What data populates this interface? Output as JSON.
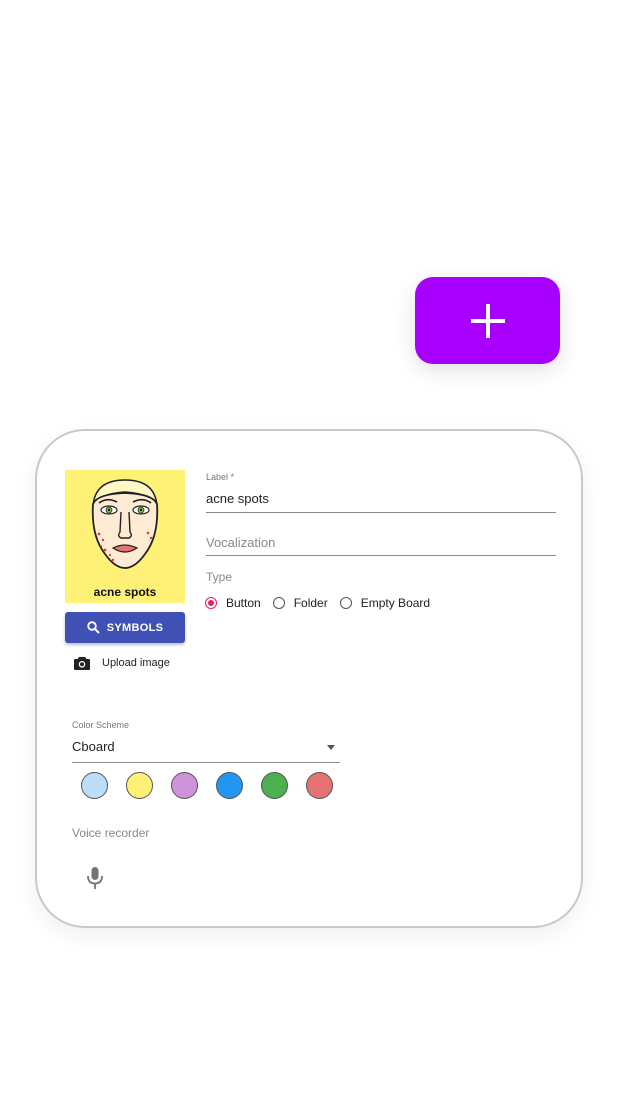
{
  "fab": {
    "icon": "plus-icon",
    "color": "#a700ff"
  },
  "tile": {
    "label": "acne spots",
    "background": "#fff176",
    "image": "face-with-acne-symbol"
  },
  "symbols_button": {
    "label": "SYMBOLS",
    "icon": "search-icon",
    "color": "#3f51b5"
  },
  "upload": {
    "label": "Upload image",
    "icon": "camera-icon"
  },
  "label_field": {
    "label": "Label *",
    "value": "acne spots"
  },
  "vocalization_field": {
    "placeholder": "Vocalization",
    "value": ""
  },
  "type": {
    "label": "Type",
    "options": [
      {
        "label": "Button",
        "checked": true
      },
      {
        "label": "Folder",
        "checked": false
      },
      {
        "label": "Empty Board",
        "checked": false
      }
    ],
    "accent": "#e91e63"
  },
  "color_scheme": {
    "label": "Color Scheme",
    "value": "Cboard",
    "swatches": [
      "#bbdefb",
      "#fff176",
      "#ce93d8",
      "#2196f3",
      "#4caf50",
      "#e57373"
    ]
  },
  "voice_recorder": {
    "label": "Voice recorder",
    "icon": "microphone-icon"
  }
}
